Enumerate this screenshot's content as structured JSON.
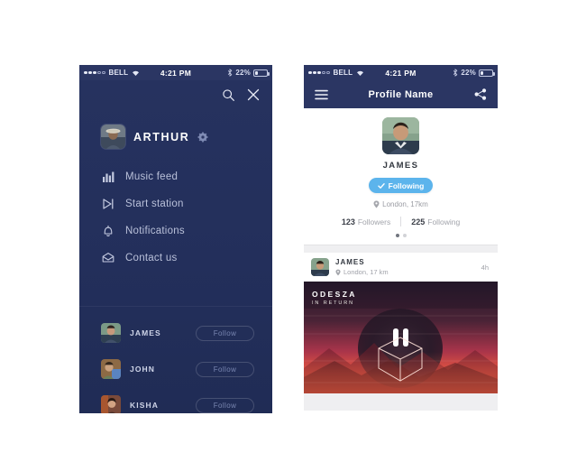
{
  "colors": {
    "navy_dark": "#23305c",
    "navy_bar": "#2b3663",
    "accent_blue": "#5cb4ec",
    "page_bg": "#ffffff",
    "feed_bg": "#efeff1"
  },
  "left_phone": {
    "status_bar": {
      "carrier": "BELL",
      "time": "4:21 PM",
      "battery_percent": "22%",
      "signal_dots_filled": 3,
      "signal_dots_empty": 2,
      "wifi_icon": "wifi-icon",
      "bluetooth_icon": "bluetooth-icon",
      "battery_icon": "battery-icon"
    },
    "top_actions": [
      {
        "name": "search-icon",
        "label": "Search"
      },
      {
        "name": "close-icon",
        "label": "Close"
      }
    ],
    "profile": {
      "name": "ARTHUR",
      "avatar_name": "arthur-avatar",
      "settings_icon": "gear-icon"
    },
    "menu": [
      {
        "label": "Music feed",
        "icon": "bar-chart-icon"
      },
      {
        "label": "Start station",
        "icon": "play-next-icon"
      },
      {
        "label": "Notifications",
        "icon": "bell-icon"
      },
      {
        "label": "Contact us",
        "icon": "envelope-icon"
      }
    ],
    "friends": [
      {
        "name": "JAMES",
        "button": "Follow",
        "avatar_name": "james-avatar"
      },
      {
        "name": "JOHN",
        "button": "Follow",
        "avatar_name": "john-avatar"
      },
      {
        "name": "KISHA",
        "button": "Follow",
        "avatar_name": "kisha-avatar"
      }
    ]
  },
  "right_phone": {
    "status_bar": {
      "carrier": "BELL",
      "time": "4:21 PM",
      "battery_percent": "22%",
      "signal_dots_filled": 3,
      "signal_dots_empty": 2,
      "wifi_icon": "wifi-icon",
      "bluetooth_icon": "bluetooth-icon",
      "battery_icon": "battery-icon"
    },
    "navbar": {
      "title": "Profile Name",
      "menu_icon": "hamburger-menu-icon",
      "share_icon": "share-icon"
    },
    "profile_card": {
      "name": "JAMES",
      "avatar_name": "james-profile-avatar",
      "follow_state_label": "Following",
      "follow_state_icon": "check-icon",
      "location": "London, 17km",
      "location_icon": "map-pin-icon",
      "stats": [
        {
          "value": "123",
          "label": "Followers"
        },
        {
          "value": "225",
          "label": "Following"
        }
      ],
      "pager_total": 2,
      "pager_active": 1
    },
    "post": {
      "author": "JAMES",
      "location": "London, 17 km",
      "location_icon": "map-pin-icon",
      "time": "4h",
      "avatar_name": "james-post-avatar",
      "album": {
        "title": "ODESZA",
        "subtitle": "IN RETURN",
        "artwork_name": "odesza-in-return-artwork",
        "overlay_icon": "pause-icon"
      }
    }
  }
}
